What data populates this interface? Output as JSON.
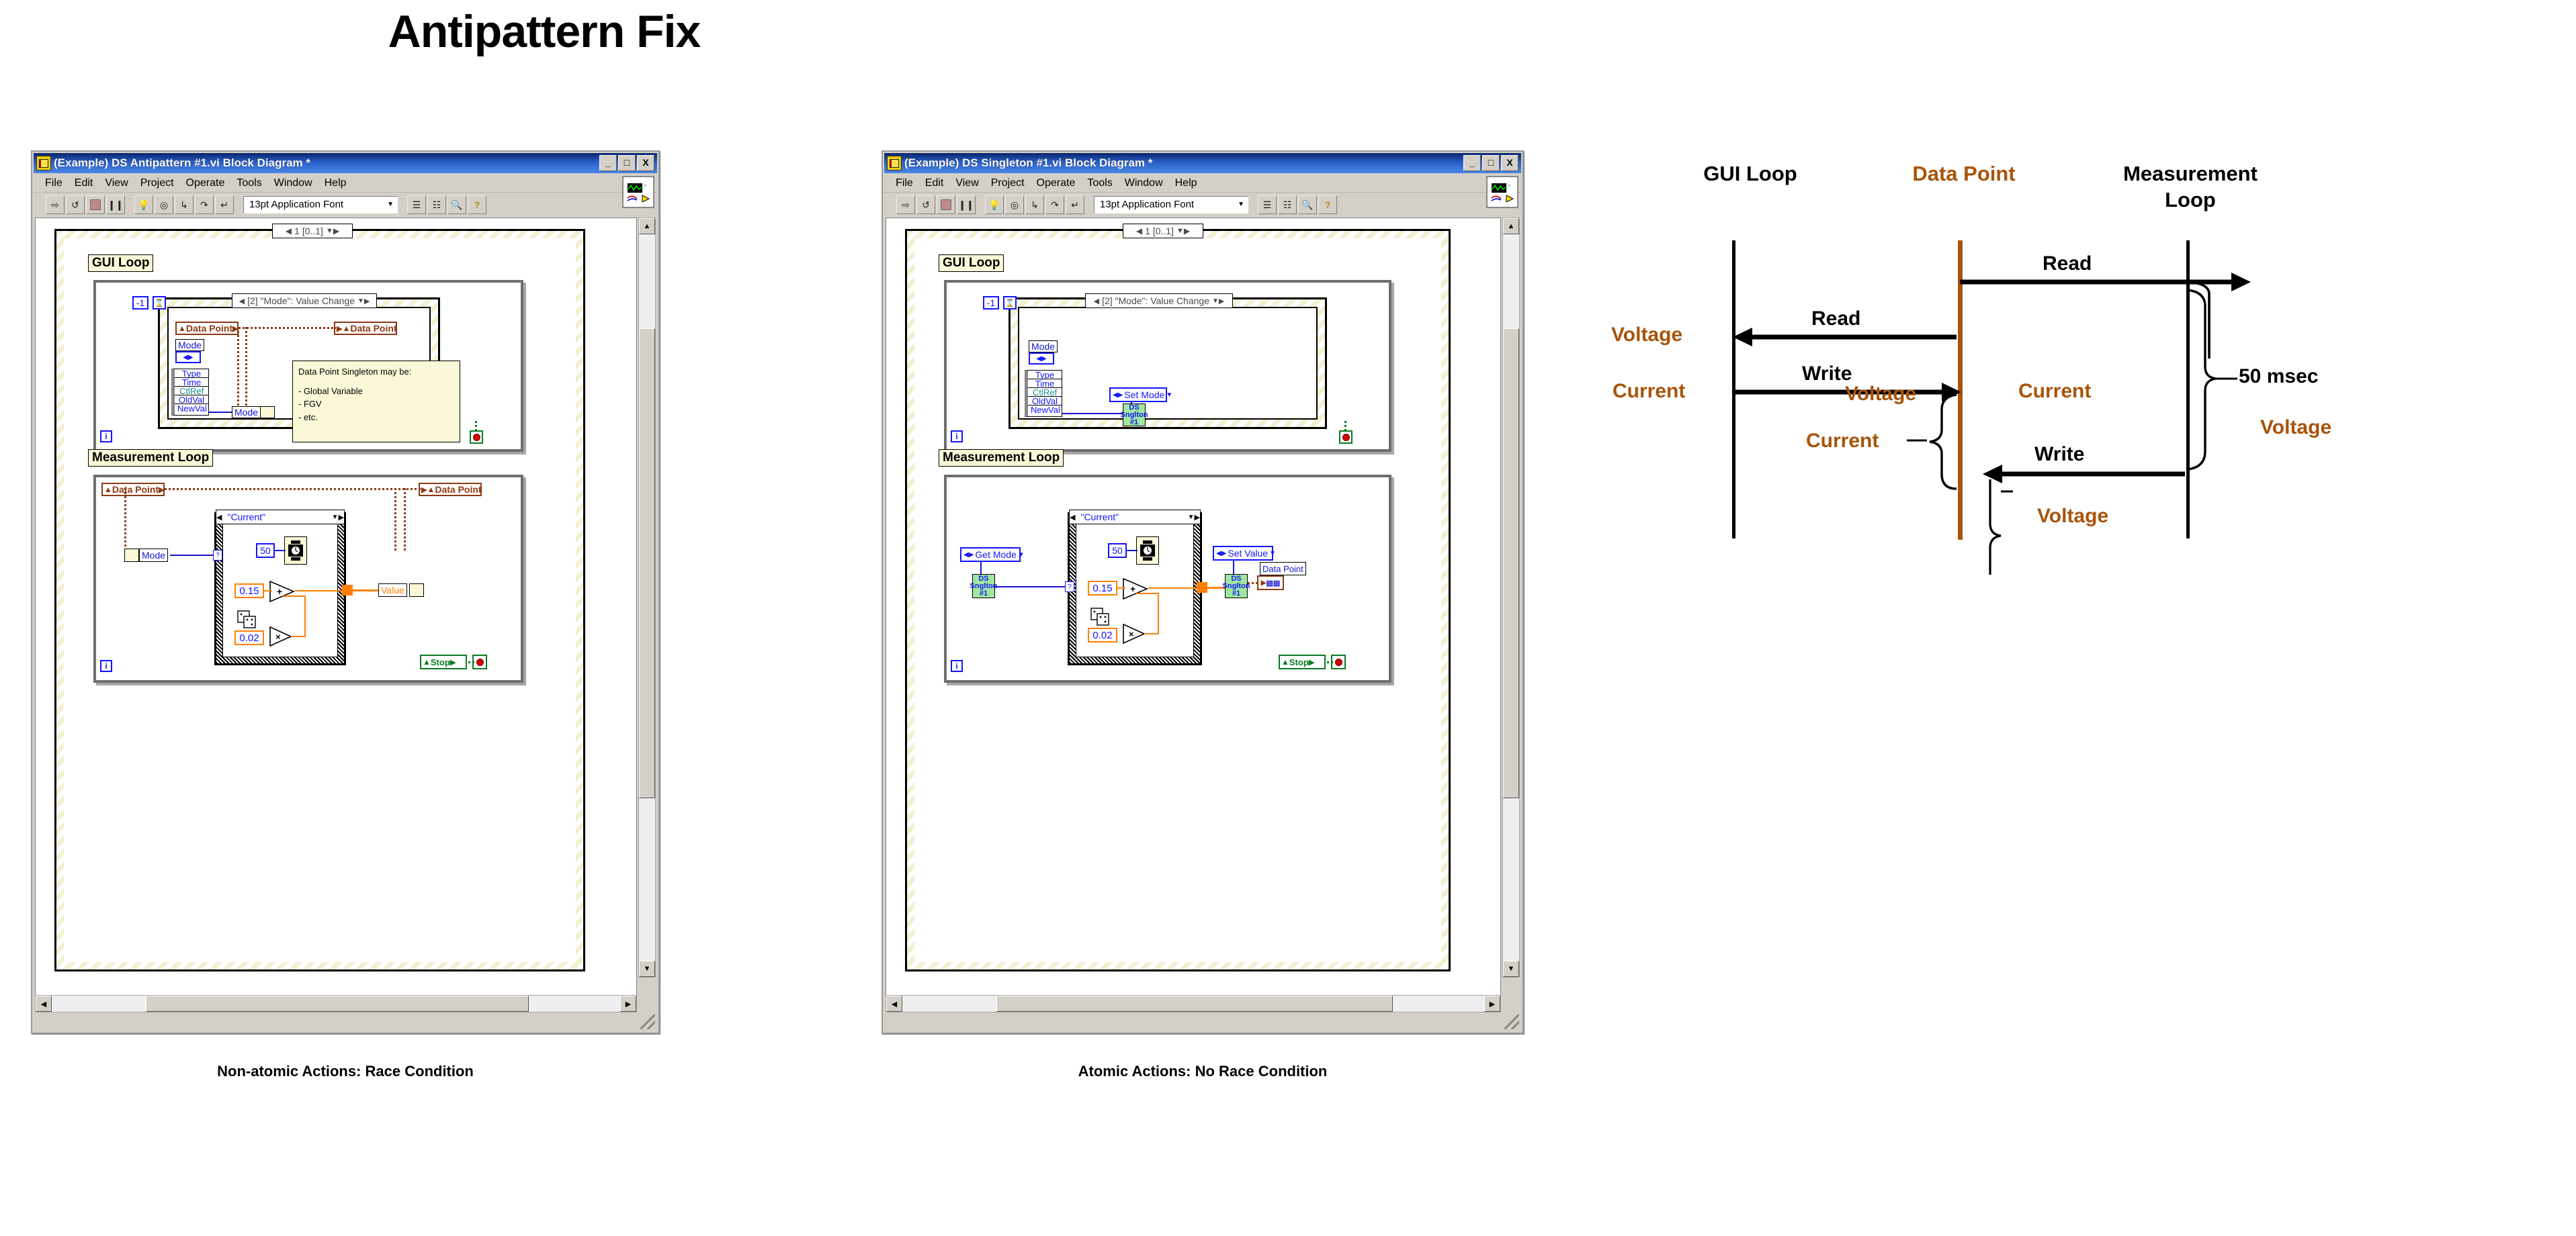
{
  "slide": {
    "title": "Antipattern Fix"
  },
  "windows": [
    {
      "id": "antipattern",
      "title": "(Example) DS Antipattern #1.vi Block Diagram *",
      "title_icon": "labview-vi-icon",
      "window_buttons": {
        "minimize": "_",
        "maximize": "□",
        "close": "X"
      },
      "menu": [
        "File",
        "Edit",
        "View",
        "Project",
        "Operate",
        "Tools",
        "Window",
        "Help"
      ],
      "toolbar": {
        "font_selector": "13pt Application Font",
        "buttons": [
          "run-button",
          "run-continuously-button",
          "abort-button",
          "pause-button",
          "highlight-execution-button",
          "retain-wire-values-button",
          "step-into-button",
          "step-over-button",
          "step-out-button",
          "align-objects-button",
          "distribute-objects-button",
          "search-button",
          "help-button"
        ]
      },
      "diagram": {
        "timed_loop_index": "1 [0..1]",
        "frames": [
          {
            "label": "GUI Loop",
            "iteration_terminal": "i",
            "timeout_value": "-1",
            "event_case": "[2] \"Mode\": Value Change",
            "event_terminals": [
              "Type",
              "Time",
              "CtlRef",
              "OldVal",
              "NewVal"
            ],
            "control_label": "Mode",
            "nodes": [
              {
                "name": "data-point-global-read",
                "label": "Data Point"
              },
              {
                "name": "data-point-global-write",
                "label": "Data Point"
              },
              {
                "name": "bundle-mode",
                "label": "Mode"
              }
            ],
            "note": {
              "heading": "Data Point Singleton may be:",
              "items": [
                "- Global Variable",
                "- FGV",
                "- etc."
              ]
            }
          },
          {
            "label": "Measurement Loop",
            "iteration_terminal": "i",
            "case_label": "\"Current\"",
            "nodes": [
              {
                "name": "data-point-global-read",
                "label": "Data Point"
              },
              {
                "name": "data-point-global-write",
                "label": "Data Point"
              },
              {
                "name": "unbundle-mode",
                "label": "Mode"
              },
              {
                "name": "bundle-value",
                "label": "Value"
              }
            ],
            "constants": [
              "50",
              "0.15",
              "0.02"
            ],
            "stop_label": "Stop"
          }
        ]
      },
      "caption": "Non-atomic Actions: Race Condition"
    },
    {
      "id": "singleton",
      "title": "(Example) DS Singleton #1.vi Block Diagram *",
      "title_icon": "labview-vi-icon",
      "window_buttons": {
        "minimize": "_",
        "maximize": "□",
        "close": "X"
      },
      "menu": [
        "File",
        "Edit",
        "View",
        "Project",
        "Operate",
        "Tools",
        "Window",
        "Help"
      ],
      "toolbar": {
        "font_selector": "13pt Application Font",
        "buttons": [
          "run-button",
          "run-continuously-button",
          "abort-button",
          "pause-button",
          "highlight-execution-button",
          "retain-wire-values-button",
          "step-into-button",
          "step-over-button",
          "step-out-button",
          "align-objects-button",
          "distribute-objects-button",
          "search-button",
          "help-button"
        ]
      },
      "diagram": {
        "timed_loop_index": "1 [0..1]",
        "frames": [
          {
            "label": "GUI Loop",
            "iteration_terminal": "i",
            "timeout_value": "-1",
            "event_case": "[2] \"Mode\": Value Change",
            "event_terminals": [
              "Type",
              "Time",
              "CtlRef",
              "OldVal",
              "NewVal"
            ],
            "control_label": "Mode",
            "nodes": [
              {
                "name": "set-mode-enum",
                "label": "Set Mode"
              },
              {
                "name": "ds-singleton-vi",
                "label": "DS\nSnglton\n#1"
              }
            ]
          },
          {
            "label": "Measurement Loop",
            "iteration_terminal": "i",
            "case_label": "\"Current\"",
            "nodes": [
              {
                "name": "get-mode-enum",
                "label": "Get Mode"
              },
              {
                "name": "ds-singleton-vi-get",
                "label": "DS\nSnglton\n#1"
              },
              {
                "name": "set-value-enum",
                "label": "Set Value"
              },
              {
                "name": "ds-singleton-vi-set",
                "label": "DS\nSnglton\n#1"
              },
              {
                "name": "data-point-indicator",
                "label": "Data Point"
              }
            ],
            "constants": [
              "50",
              "0.15",
              "0.02"
            ],
            "stop_label": "Stop"
          }
        ]
      },
      "caption": "Atomic Actions: No Race Condition"
    }
  ],
  "sequence_diagram": {
    "headers": [
      {
        "name": "gui-loop",
        "label": "GUI Loop",
        "color": "#000000"
      },
      {
        "name": "data-point",
        "label": "Data Point",
        "color": "#a8540b"
      },
      {
        "name": "measurement-loop",
        "label": "Measurement\nLoop",
        "color": "#000000"
      }
    ],
    "values": [
      {
        "name": "datapoint-voltage-top",
        "label": "Voltage"
      },
      {
        "name": "measurement-voltage",
        "label": "Voltage"
      },
      {
        "name": "gui-voltage",
        "label": "Voltage"
      },
      {
        "name": "gui-current",
        "label": "Current"
      },
      {
        "name": "datapoint-current",
        "label": "Current"
      },
      {
        "name": "bracket-current",
        "label": "Current"
      },
      {
        "name": "bracket-voltage",
        "label": "Voltage"
      }
    ],
    "messages": [
      {
        "name": "read-datapoint-to-measurement",
        "label": "Read",
        "direction": "right"
      },
      {
        "name": "read-datapoint-to-gui",
        "label": "Read",
        "direction": "left"
      },
      {
        "name": "write-gui-to-datapoint",
        "label": "Write",
        "direction": "right"
      },
      {
        "name": "write-measurement-to-datapoint",
        "label": "Write",
        "direction": "left"
      }
    ],
    "duration": {
      "name": "loop-period",
      "label": "50 msec"
    },
    "colors": {
      "accent_brown": "#a8540b",
      "line_black": "#000000"
    }
  }
}
